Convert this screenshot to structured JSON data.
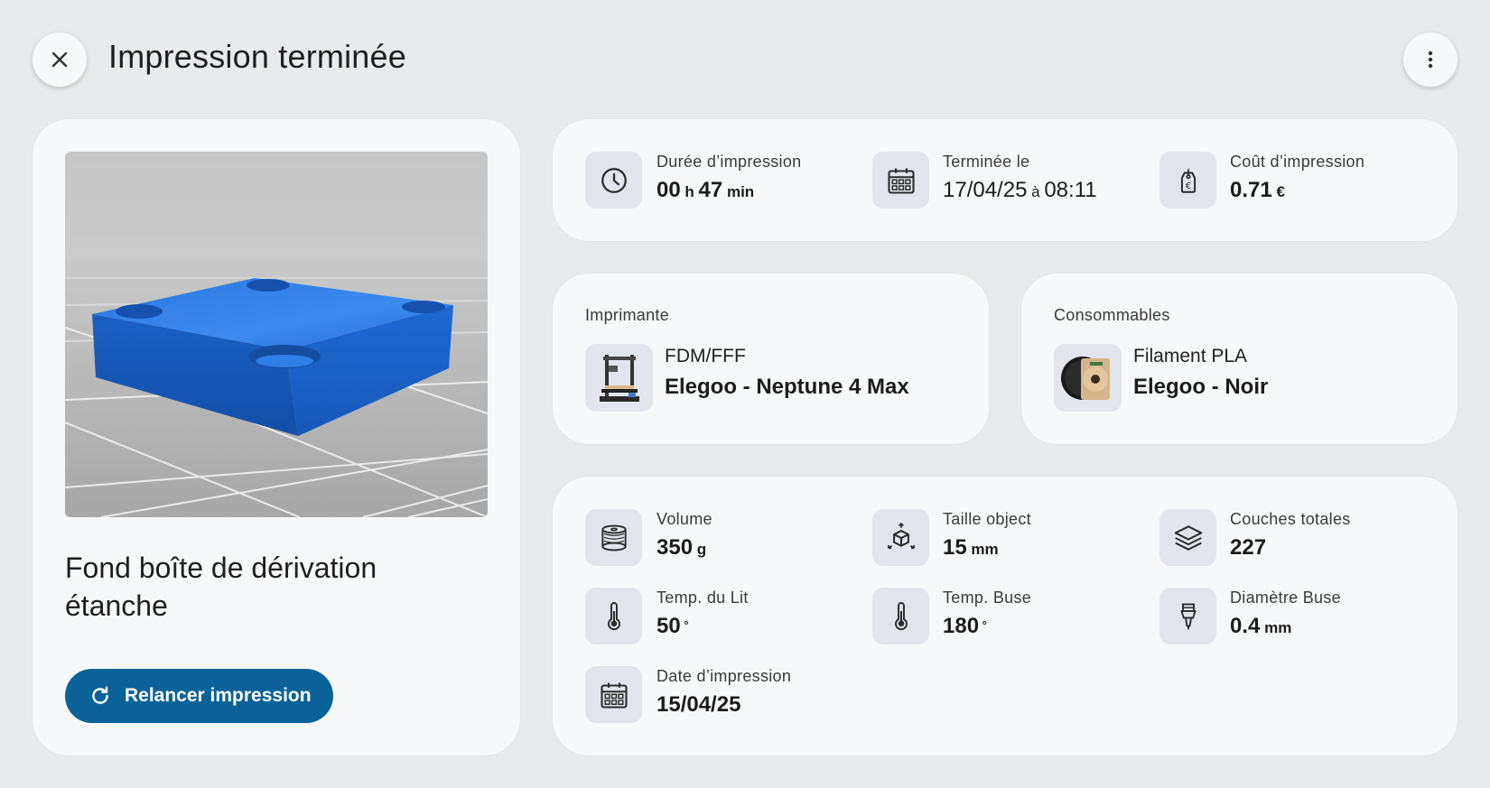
{
  "header": {
    "title": "Impression terminée"
  },
  "model": {
    "name": "Fond boîte de dérivation étanche",
    "replay_label": "Relancer impression"
  },
  "stats": [
    {
      "label": "Durée d’impression",
      "parts": [
        [
          "00",
          " h "
        ],
        [
          "47",
          " min"
        ]
      ],
      "icon": "clock-icon"
    },
    {
      "label": "Terminée le",
      "parts": [
        [
          "17/04/25",
          " à "
        ],
        [
          "08:11",
          ""
        ]
      ],
      "icon": "calendar-icon"
    },
    {
      "label": "Coût d’impression",
      "parts": [
        [
          "0.71",
          " €"
        ]
      ],
      "icon": "price-tag-icon"
    }
  ],
  "printer": {
    "section": "Imprimante",
    "type": "FDM/FFF",
    "name": "Elegoo - Neptune 4 Max",
    "icon": "printer-image"
  },
  "consumables": {
    "section": "Consommables",
    "type": "Filament PLA",
    "name": "Elegoo - Noir",
    "icon": "filament-spool-image"
  },
  "details": [
    {
      "label": "Volume",
      "value": "350",
      "unit": " g",
      "icon": "spool-icon"
    },
    {
      "label": "Taille object",
      "value": "15",
      "unit": " mm",
      "icon": "cube-icon"
    },
    {
      "label": "Couches totales",
      "value": "227",
      "unit": "",
      "icon": "layers-icon"
    },
    {
      "label": "Temp. du Lit",
      "value": "50",
      "unit": " °",
      "icon": "thermometer-icon"
    },
    {
      "label": "Temp. Buse",
      "value": "180",
      "unit": " °",
      "icon": "thermometer-icon"
    },
    {
      "label": "Diamètre Buse",
      "value": "0.4",
      "unit": " mm",
      "icon": "nozzle-icon"
    },
    {
      "label": "Date d’impression",
      "value": "15/04/25",
      "unit": "",
      "icon": "calendar-icon"
    }
  ],
  "colors": {
    "background": "#e9eaec",
    "card": "#f7f8fa",
    "accent": "#0b6298",
    "icon_bg": "#e2e6ec",
    "model_blue": "#1f6fd6"
  }
}
